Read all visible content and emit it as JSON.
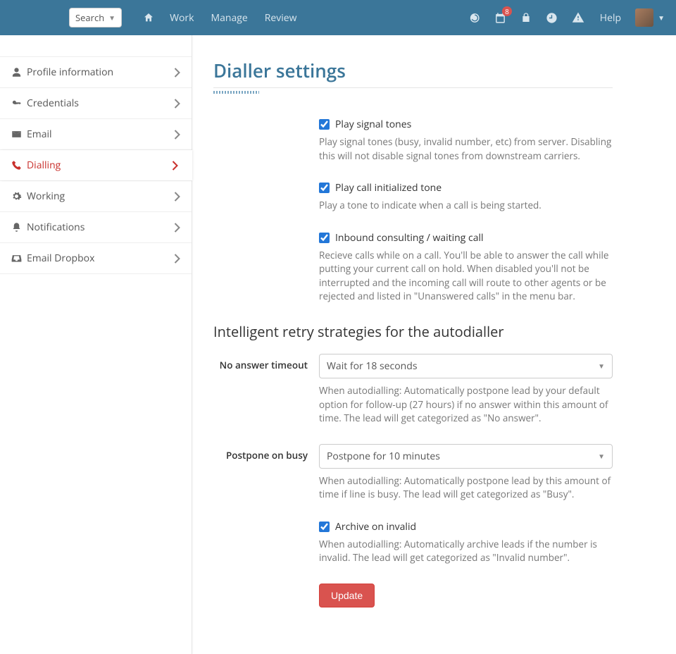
{
  "topbar": {
    "search_label": "Search",
    "nav": {
      "work": "Work",
      "manage": "Manage",
      "review": "Review"
    },
    "help": "Help",
    "calendar_badge": "8"
  },
  "sidebar": {
    "items": [
      {
        "label": "Profile information"
      },
      {
        "label": "Credentials"
      },
      {
        "label": "Email"
      },
      {
        "label": "Dialling"
      },
      {
        "label": "Working"
      },
      {
        "label": "Notifications"
      },
      {
        "label": "Email Dropbox"
      }
    ]
  },
  "page": {
    "title": "Dialler settings",
    "opt1": {
      "label": "Play signal tones",
      "help": "Play signal tones (busy, invalid number, etc) from server. Disabling this will not disable signal tones from downstream carriers."
    },
    "opt2": {
      "label": "Play call initialized tone",
      "help": "Play a tone to indicate when a call is being started."
    },
    "opt3": {
      "label": "Inbound consulting / waiting call",
      "help": "Recieve calls while on a call. You'll be able to answer the call while putting your current call on hold. When disabled you'll not be interrupted and the incoming call will route to other agents or be rejected and listed in \"Unanswered calls\" in the menu bar."
    },
    "section2": "Intelligent retry strategies for the autodialler",
    "no_answer": {
      "label": "No answer timeout",
      "value": "Wait for 18 seconds",
      "help": "When autodialling: Automatically postpone lead by your default option for follow-up (27 hours) if no answer within this amount of time. The lead will get categorized as \"No answer\"."
    },
    "postpone": {
      "label": "Postpone on busy",
      "value": "Postpone for 10 minutes",
      "help": "When autodialling: Automatically postpone lead by this amount of time if line is busy. The lead will get categorized as \"Busy\"."
    },
    "archive": {
      "label": "Archive on invalid",
      "help": "When autodialling: Automatically archive leads if the number is invalid. The lead will get categorized as \"Invalid number\"."
    },
    "update": "Update"
  }
}
